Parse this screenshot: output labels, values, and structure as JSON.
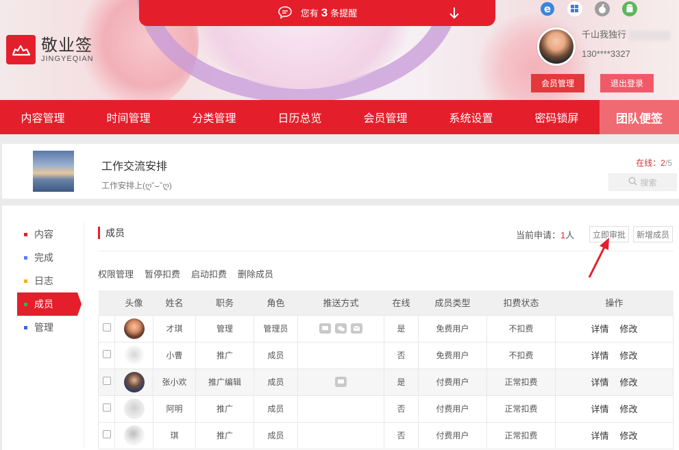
{
  "header": {
    "logo_cn": "敬业签",
    "logo_en": "JINGYEQIAN",
    "notice_prefix": "您有",
    "notice_count": "3",
    "notice_suffix": "条提醒",
    "platform_icons": [
      "ie-icon",
      "windows-icon",
      "apple-icon",
      "android-icon"
    ],
    "user_name": "千山我独行",
    "user_phone": "130****3327",
    "member_btn": "会员管理",
    "logout_btn": "退出登录"
  },
  "nav": {
    "items": [
      "内容管理",
      "时间管理",
      "分类管理",
      "日历总览",
      "会员管理",
      "系统设置",
      "密码锁屏"
    ],
    "active": "团队便签"
  },
  "group": {
    "title": "工作交流安排",
    "desc": "工作安排上(ღ˘⌣˘ღ)",
    "online_label": "在线：",
    "online_count": "2",
    "online_total": "/5",
    "search": "搜索"
  },
  "sidebar": {
    "items": [
      {
        "label": "内容",
        "color": "#e41f2b"
      },
      {
        "label": "完成",
        "color": "#5b7cf5"
      },
      {
        "label": "日志",
        "color": "#f0b400"
      },
      {
        "label": "成员",
        "color": "#2db84d"
      },
      {
        "label": "管理",
        "color": "#3d62e6"
      }
    ],
    "active_index": 3
  },
  "members": {
    "title": "成员",
    "apply_label": "当前申请：",
    "apply_count": "1",
    "apply_unit": "人",
    "approve_btn": "立即审批",
    "add_btn": "新增成员",
    "actions": [
      "权限管理",
      "暂停扣费",
      "启动扣费",
      "删除成员"
    ],
    "columns": [
      "",
      "头像",
      "姓名",
      "职务",
      "角色",
      "推送方式",
      "在线",
      "成员类型",
      "扣费状态",
      "操作"
    ],
    "rows": [
      {
        "name": "才琪",
        "job": "管理",
        "role": "管理员",
        "push": [
          "chat-icon",
          "wechat-icon",
          "mail-icon"
        ],
        "online": "是",
        "type": "免费用户",
        "fee": "不扣费",
        "detail": "详情",
        "edit": "修改"
      },
      {
        "name": "小曹",
        "job": "推广",
        "role": "成员",
        "push": [],
        "online": "否",
        "type": "免费用户",
        "fee": "不扣费",
        "detail": "详情",
        "edit": "修改"
      },
      {
        "name": "张小欢",
        "job": "推广编辑",
        "role": "成员",
        "push": [
          "chat-icon"
        ],
        "online": "是",
        "type": "付费用户",
        "fee": "正常扣费",
        "detail": "详情",
        "edit": "修改"
      },
      {
        "name": "阿明",
        "job": "推广",
        "role": "成员",
        "push": [],
        "online": "否",
        "type": "付费用户",
        "fee": "正常扣费",
        "detail": "详情",
        "edit": "修改"
      },
      {
        "name": "琪",
        "job": "推广",
        "role": "成员",
        "push": [],
        "online": "否",
        "type": "付费用户",
        "fee": "正常扣费",
        "detail": "详情",
        "edit": "修改"
      }
    ]
  },
  "colors": {
    "accent": "#e41f2b",
    "nav_active": "#ef6b71"
  }
}
